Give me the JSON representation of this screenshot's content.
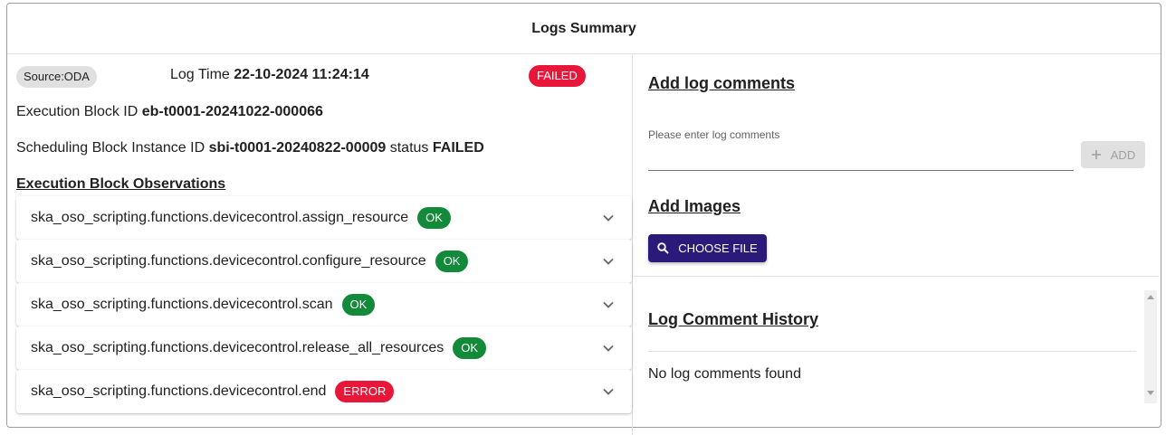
{
  "dialog": {
    "title": "Logs Summary"
  },
  "log": {
    "source_chip": "Source:ODA",
    "time_label": "Log Time",
    "time_value": "22-10-2024 11:24:14",
    "status_chip": "FAILED",
    "eb_label": "Execution Block ID",
    "eb_value": "eb-t0001-20241022-000066",
    "sbi_label": "Scheduling Block Instance ID",
    "sbi_value": "sbi-t0001-20240822-00009",
    "sbi_status_label": "status",
    "sbi_status_value": "FAILED",
    "observations_heading": "Execution Block Observations",
    "observations": [
      {
        "name": "ska_oso_scripting.functions.devicecontrol.assign_resource",
        "status": "OK"
      },
      {
        "name": "ska_oso_scripting.functions.devicecontrol.configure_resource",
        "status": "OK"
      },
      {
        "name": "ska_oso_scripting.functions.devicecontrol.scan",
        "status": "OK"
      },
      {
        "name": "ska_oso_scripting.functions.devicecontrol.release_all_resources",
        "status": "OK"
      },
      {
        "name": "ska_oso_scripting.functions.devicecontrol.end",
        "status": "ERROR"
      }
    ]
  },
  "comments": {
    "heading": "Add log comments",
    "field_label": "Please enter log comments",
    "field_value": "",
    "add_label": "ADD"
  },
  "images": {
    "heading": "Add Images",
    "choose_label": "CHOOSE FILE"
  },
  "history": {
    "heading": "Log Comment History",
    "empty_text": "No log comments found"
  },
  "colors": {
    "ok": "#128a3a",
    "error": "#e8173a",
    "failed": "#e8173a",
    "primary": "#2c1a7a"
  },
  "icons": {
    "add": "plus-icon",
    "choose": "search-icon",
    "expand": "chevron-down-icon"
  }
}
